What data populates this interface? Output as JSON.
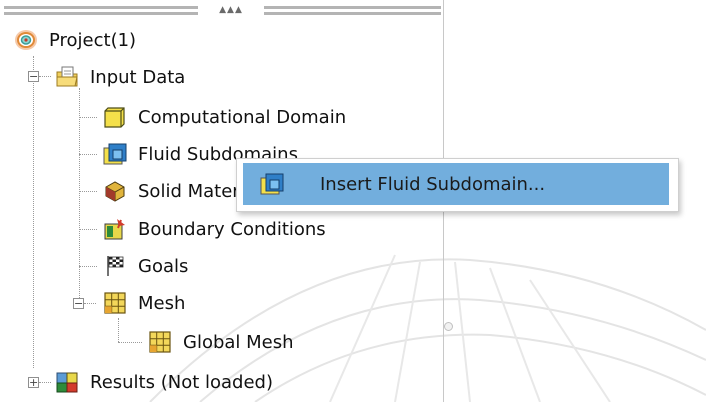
{
  "tree": {
    "project": {
      "label": "Project(1)",
      "icon": "project-icon"
    },
    "input_data": {
      "label": "Input Data",
      "icon": "folder-input-icon",
      "expander": "−"
    },
    "computational_domain": {
      "label": "Computational Domain",
      "icon": "domain-box-icon"
    },
    "fluid_subdomains": {
      "label": "Fluid Subdomains",
      "icon": "fluid-subdomain-icon"
    },
    "solid_materials": {
      "label": "Solid Materials",
      "icon": "solid-material-icon"
    },
    "boundary_conditions": {
      "label": "Boundary Conditions",
      "icon": "boundary-conditions-icon"
    },
    "goals": {
      "label": "Goals",
      "icon": "goals-flag-icon"
    },
    "mesh": {
      "label": "Mesh",
      "icon": "mesh-icon",
      "expander": "−"
    },
    "global_mesh": {
      "label": "Global Mesh",
      "icon": "mesh-icon"
    },
    "results": {
      "label": "Results (Not loaded)",
      "icon": "results-icon",
      "expander": "+"
    }
  },
  "splitter": {
    "grip": "▲▲▲"
  },
  "context_menu": {
    "items": [
      {
        "label": "Insert Fluid Subdomain...",
        "icon": "fluid-subdomain-icon",
        "highlighted": true
      }
    ]
  },
  "colors": {
    "menu_highlight": "#72aedd",
    "tree_lines": "#9a9a9a"
  }
}
